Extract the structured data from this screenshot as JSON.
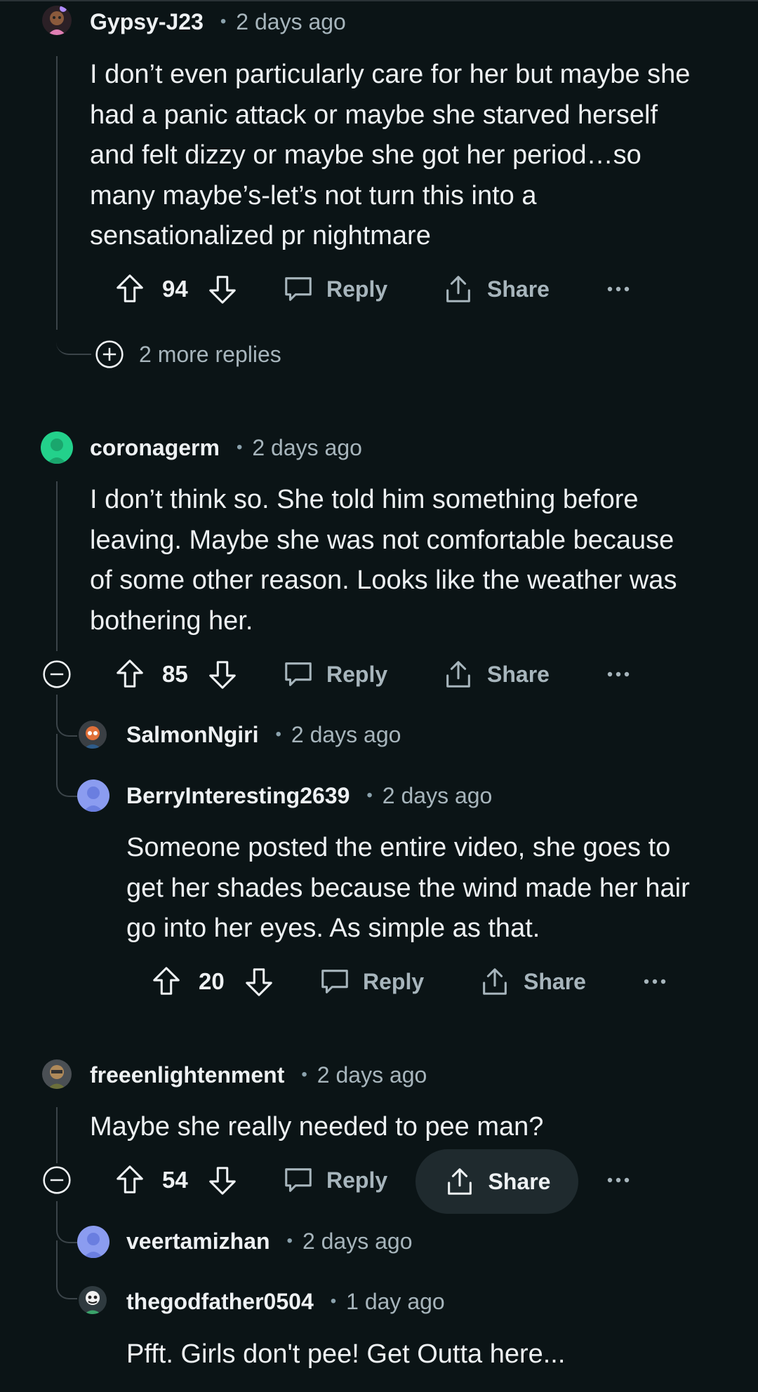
{
  "comments": {
    "c1": {
      "username": "Gypsy-J23",
      "time": "2 days ago",
      "lines": [
        "I don’t even particularly care for her but maybe she",
        "had a panic attack or maybe she starved herself",
        "and felt dizzy or maybe she got her period…so",
        "many maybe’s-let’s not turn this into a",
        "sensationalized pr nightmare"
      ],
      "votes": "94",
      "reply_label": "Reply",
      "share_label": "Share",
      "more_replies": "2 more replies"
    },
    "c2": {
      "username": "coronagerm",
      "time": "2 days ago",
      "lines": [
        "I don’t think so. She told him something before",
        "leaving. Maybe she was not comfortable because",
        "of some other reason. Looks like the weather was",
        "bothering her."
      ],
      "votes": "85",
      "reply_label": "Reply",
      "share_label": "Share"
    },
    "c2r1": {
      "username": "SalmonNgiri",
      "time": "2 days ago"
    },
    "c2r2": {
      "username": "BerryInteresting2639",
      "time": "2 days ago",
      "lines": [
        "Someone posted the entire video, she goes to",
        "get her shades because the wind made her hair",
        "go into her eyes. As simple as that."
      ],
      "votes": "20",
      "reply_label": "Reply",
      "share_label": "Share"
    },
    "c3": {
      "username": "freeenlightenment",
      "time": "2 days ago",
      "lines": [
        "Maybe she really needed to pee man?"
      ],
      "votes": "54",
      "reply_label": "Reply",
      "share_label": "Share"
    },
    "c3r1": {
      "username": "veertamizhan",
      "time": "2 days ago"
    },
    "c3r2": {
      "username": "thegodfather0504",
      "time": "1 day ago",
      "lines": [
        "Pfft. Girls don't pee! Get Outta here..."
      ]
    }
  },
  "icons": {
    "upvote": "upvote-icon",
    "downvote": "downvote-icon",
    "reply": "reply-bubble-icon",
    "share": "share-icon",
    "more": "more-options-icon",
    "expand": "plus-circle-icon",
    "collapse": "minus-circle-icon"
  },
  "colors": {
    "background": "#0b1416",
    "text": "#eef1f3",
    "muted": "#a7b5bc",
    "thread_line": "#3b4449",
    "share_pill": "#1f2a2e"
  }
}
